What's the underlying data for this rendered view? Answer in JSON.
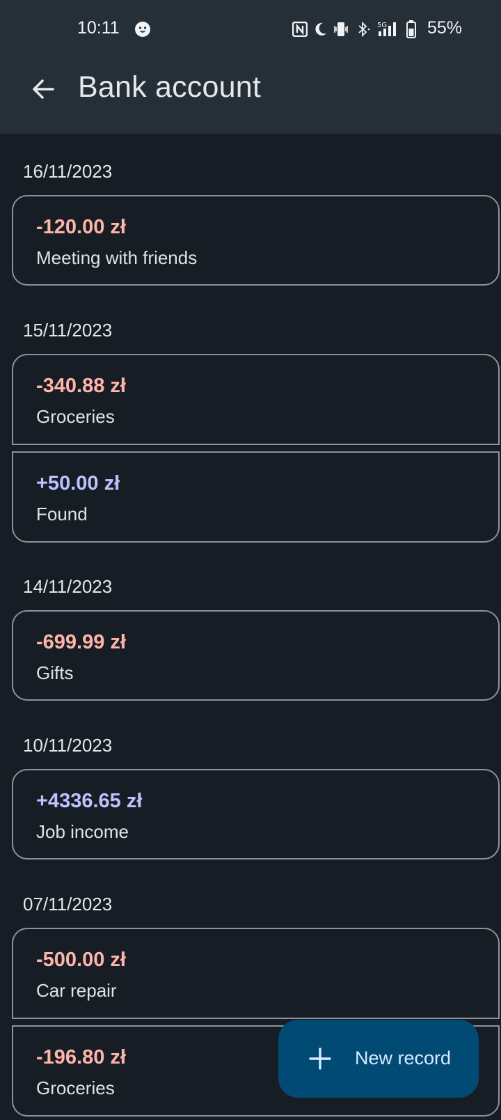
{
  "status_bar": {
    "time": "10:11",
    "battery": "55%",
    "icons": [
      "face-icon",
      "nfc-icon",
      "moon-icon",
      "vibrate-icon",
      "bluetooth-icon",
      "5g-signal-icon",
      "battery-icon"
    ]
  },
  "header": {
    "title": "Bank account"
  },
  "groups": [
    {
      "date": "16/11/2023",
      "records": [
        {
          "amount": "-120.00 zł",
          "description": "Meeting with friends",
          "sign": "negative"
        }
      ]
    },
    {
      "date": "15/11/2023",
      "records": [
        {
          "amount": "-340.88 zł",
          "description": "Groceries",
          "sign": "negative"
        },
        {
          "amount": "+50.00 zł",
          "description": "Found",
          "sign": "positive"
        }
      ]
    },
    {
      "date": "14/11/2023",
      "records": [
        {
          "amount": "-699.99 zł",
          "description": "Gifts",
          "sign": "negative"
        }
      ]
    },
    {
      "date": "10/11/2023",
      "records": [
        {
          "amount": "+4336.65 zł",
          "description": "Job income",
          "sign": "positive"
        }
      ]
    },
    {
      "date": "07/11/2023",
      "records": [
        {
          "amount": "-500.00 zł",
          "description": "Car repair",
          "sign": "negative"
        },
        {
          "amount": "-196.80 zł",
          "description": "Groceries",
          "sign": "negative"
        }
      ]
    }
  ],
  "fab": {
    "label": "New record",
    "icon": "plus-icon"
  },
  "colors": {
    "background": "#161d24",
    "top_bar": "#252f38",
    "negative_amount": "#ffb4a9",
    "positive_amount": "#bcc3ff",
    "card_outline": "#8c9299",
    "fab_background": "#004a73"
  }
}
